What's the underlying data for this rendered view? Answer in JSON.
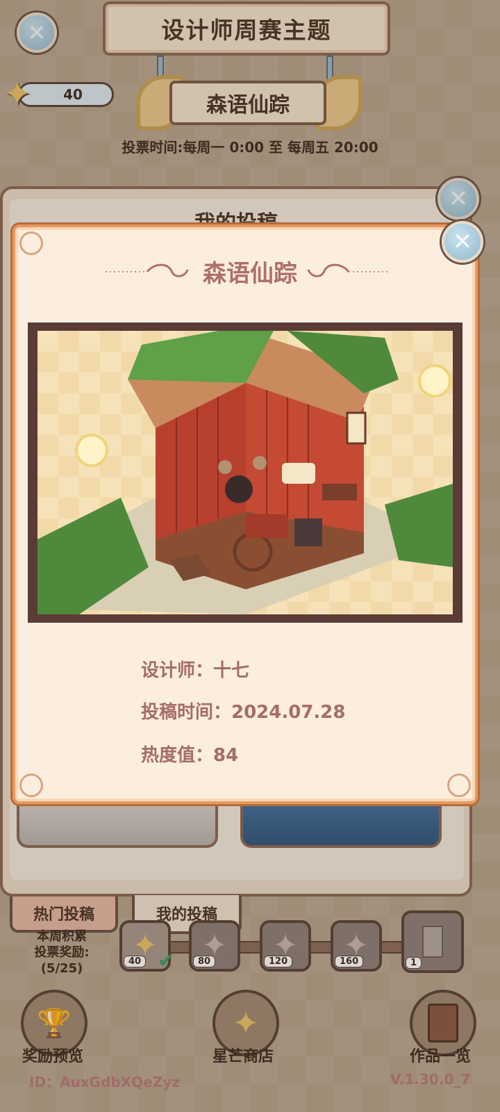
{
  "header": {
    "title": "设计师周赛主题",
    "theme_name": "森语仙踪",
    "vote_time": "投票时间:每周一 0:00 至 每周五 20:00",
    "star_count": "40"
  },
  "background_panel": {
    "title": "我的投稿"
  },
  "tabs": [
    {
      "label": "热门投稿"
    },
    {
      "label": "我的投稿"
    }
  ],
  "rewards": {
    "label_line1": "本周积累",
    "label_line2": "投票奖励:",
    "label_line3": "(5/25)",
    "milestones": [
      "40",
      "80",
      "120",
      "160",
      "1"
    ]
  },
  "bottom_nav": {
    "reward_preview": "奖励预览",
    "star_shop": "星芒商店",
    "works_list": "作品一览"
  },
  "footer": {
    "id_label": "ID：",
    "id_value": "AuxGdbXQeZyz",
    "version": "V.1.30.0_7"
  },
  "modal": {
    "title": "森语仙踪",
    "designer": "设计师：十七",
    "submit_time": "投稿时间：2024.07.28",
    "heat": "热度值：84"
  },
  "colors": {
    "modal_border": "#e69a5e",
    "modal_bg": "#fbeede",
    "info_text": "#a56c6a",
    "close_button": "#a9cbdc"
  }
}
